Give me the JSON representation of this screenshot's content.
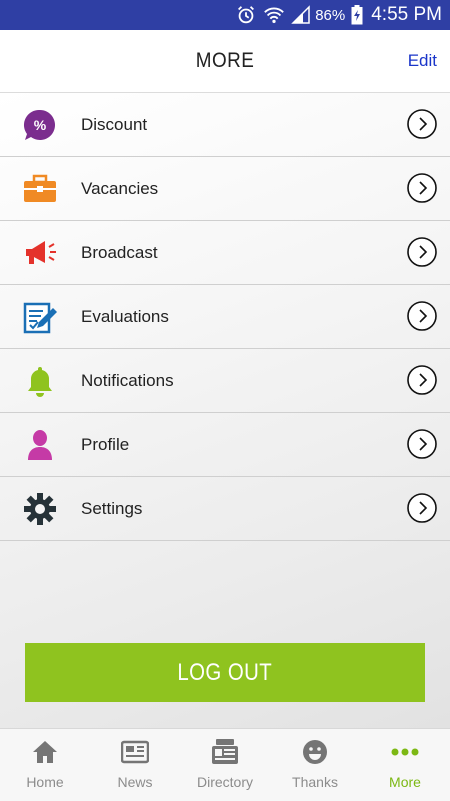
{
  "status_bar": {
    "battery": "86%",
    "time": "4:55 PM"
  },
  "header": {
    "title": "MORE",
    "edit_label": "Edit"
  },
  "menu": {
    "items": [
      {
        "label": "Discount",
        "icon": "discount-icon",
        "color": "#7b2d8e"
      },
      {
        "label": "Vacancies",
        "icon": "briefcase-icon",
        "color": "#f08a24"
      },
      {
        "label": "Broadcast",
        "icon": "megaphone-icon",
        "color": "#e4322b"
      },
      {
        "label": "Evaluations",
        "icon": "evaluation-icon",
        "color": "#1a6fb5"
      },
      {
        "label": "Notifications",
        "icon": "bell-icon",
        "color": "#8fc31f"
      },
      {
        "label": "Profile",
        "icon": "profile-icon",
        "color": "#c53aa6"
      },
      {
        "label": "Settings",
        "icon": "gear-icon",
        "color": "#263238"
      }
    ]
  },
  "logout": {
    "label": "LOG OUT",
    "color": "#8fc31f"
  },
  "tabbar": {
    "tabs": [
      {
        "label": "Home",
        "icon": "home-icon"
      },
      {
        "label": "News",
        "icon": "newspaper-icon"
      },
      {
        "label": "Directory",
        "icon": "directory-icon"
      },
      {
        "label": "Thanks",
        "icon": "smiley-icon"
      },
      {
        "label": "More",
        "icon": "more-dots-icon",
        "active": true
      }
    ],
    "active_color": "#7cb814",
    "inactive_color": "#8c8c8c"
  }
}
